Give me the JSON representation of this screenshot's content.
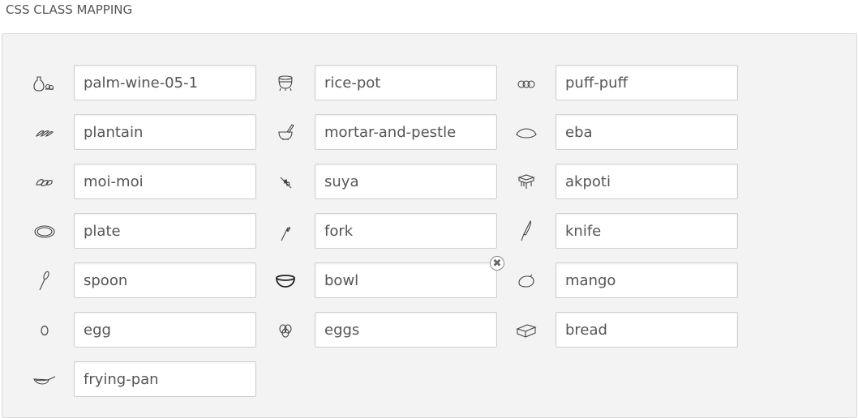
{
  "section": {
    "title": "CSS CLASS MAPPING"
  },
  "mappings": [
    {
      "icon": "palm-wine-icon",
      "value": "palm-wine-05-1"
    },
    {
      "icon": "rice-pot-icon",
      "value": "rice-pot"
    },
    {
      "icon": "puff-puff-icon",
      "value": "puff-puff"
    },
    {
      "icon": "plantain-icon",
      "value": "plantain"
    },
    {
      "icon": "mortar-and-pestle-icon",
      "value": "mortar-and-pestle"
    },
    {
      "icon": "eba-icon",
      "value": "eba"
    },
    {
      "icon": "moi-moi-icon",
      "value": "moi-moi"
    },
    {
      "icon": "suya-icon",
      "value": "suya"
    },
    {
      "icon": "akpoti-icon",
      "value": "akpoti"
    },
    {
      "icon": "plate-icon",
      "value": "plate"
    },
    {
      "icon": "fork-icon",
      "value": "fork"
    },
    {
      "icon": "knife-icon",
      "value": "knife"
    },
    {
      "icon": "spoon-icon",
      "value": "spoon"
    },
    {
      "icon": "bowl-icon",
      "value": "bowl"
    },
    {
      "icon": "mango-icon",
      "value": "mango"
    },
    {
      "icon": "egg-icon",
      "value": "egg"
    },
    {
      "icon": "eggs-icon",
      "value": "eggs"
    },
    {
      "icon": "bread-icon",
      "value": "bread"
    },
    {
      "icon": "frying-pan-icon",
      "value": "frying-pan"
    }
  ],
  "clear_button": {
    "symbol": "✖"
  }
}
